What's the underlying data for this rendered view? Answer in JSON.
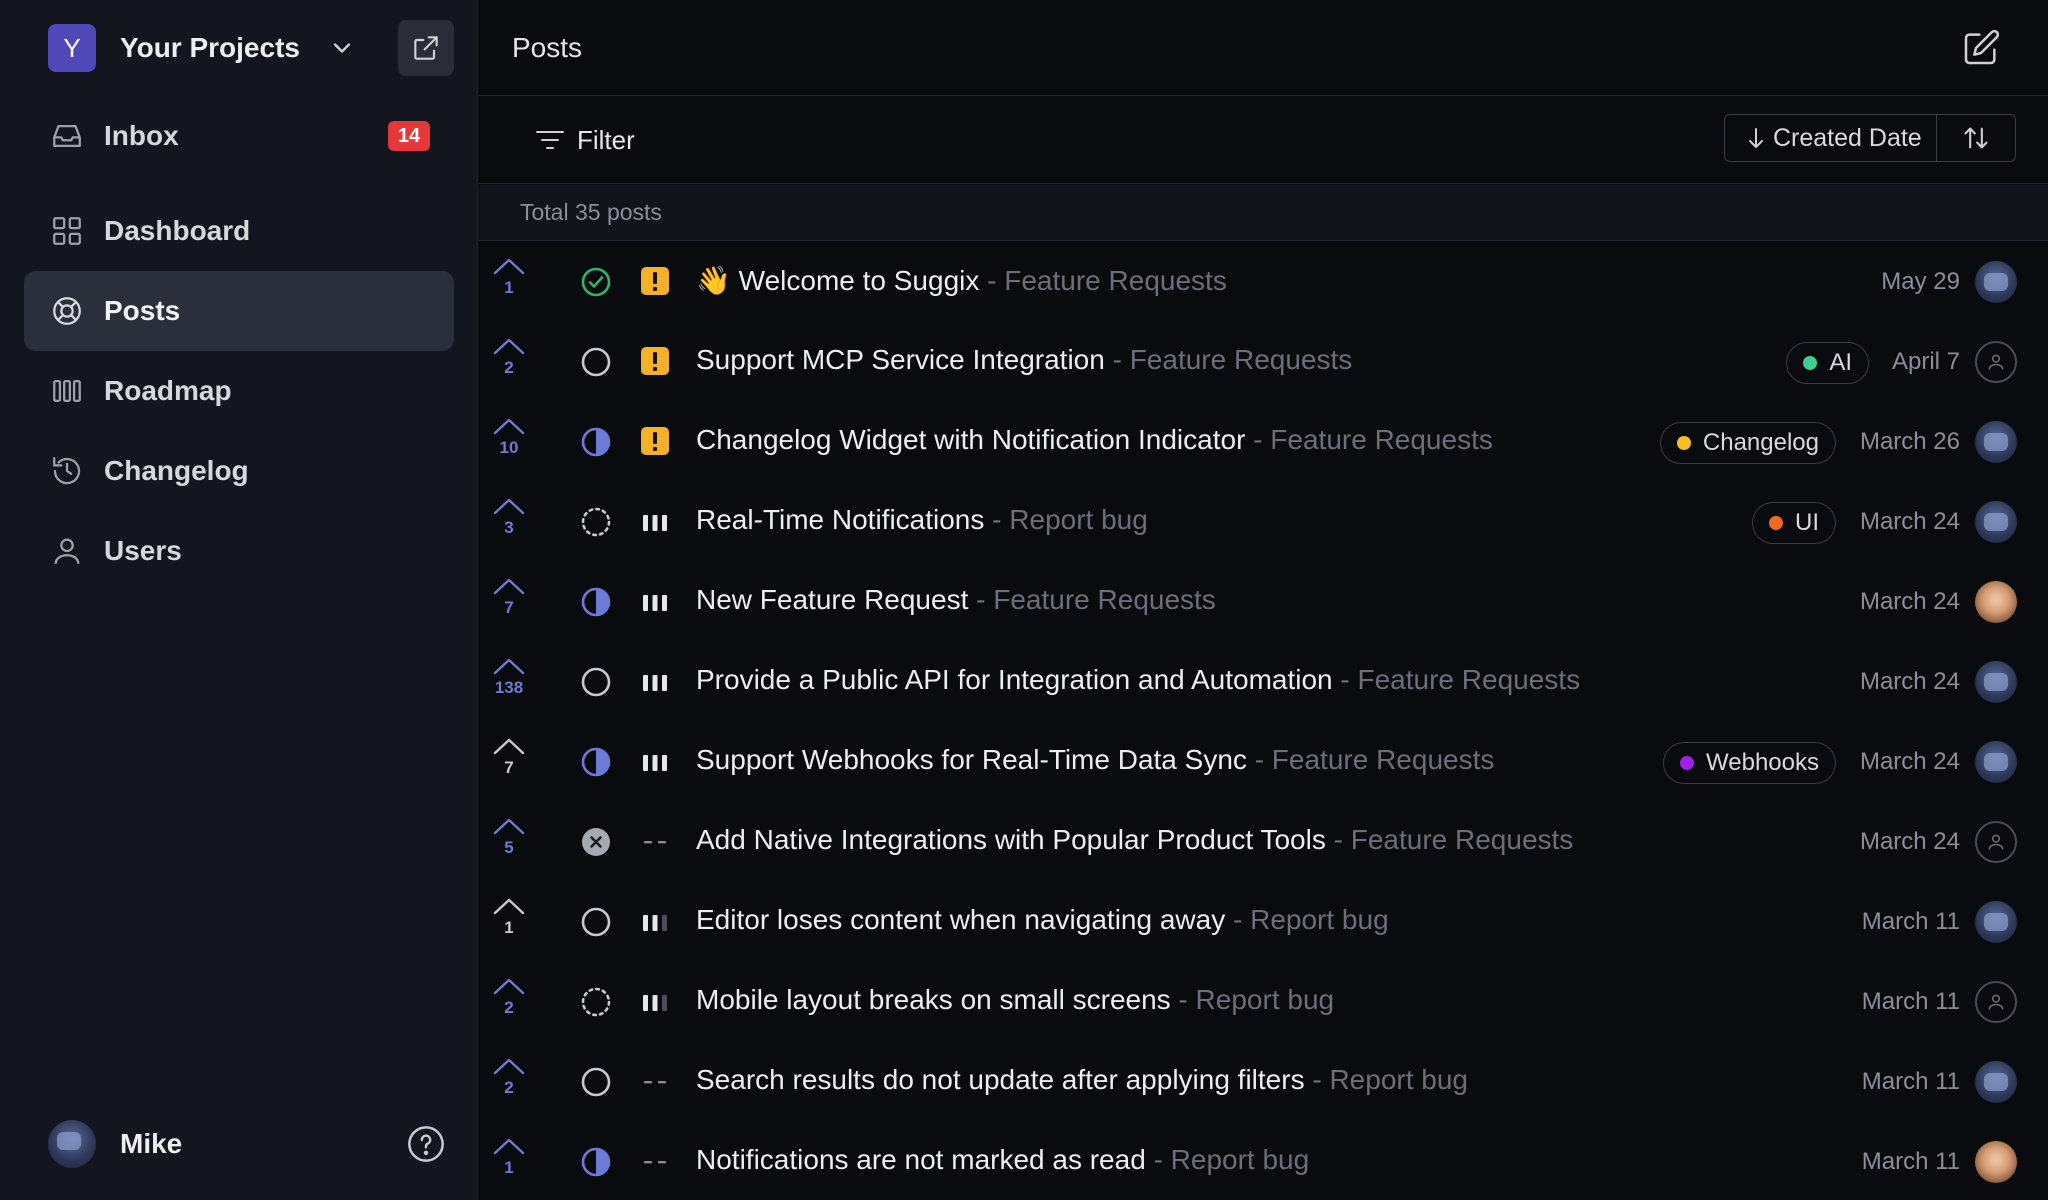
{
  "workspace": {
    "initial": "Y",
    "name": "Your Projects"
  },
  "nav": [
    {
      "label": "Inbox",
      "icon": "inbox-icon",
      "badge": "14"
    },
    {
      "label": "Dashboard",
      "icon": "dashboard-icon"
    },
    {
      "label": "Posts",
      "icon": "posts-icon",
      "active": true
    },
    {
      "label": "Roadmap",
      "icon": "roadmap-icon"
    },
    {
      "label": "Changelog",
      "icon": "changelog-icon"
    },
    {
      "label": "Users",
      "icon": "users-icon"
    }
  ],
  "user": {
    "name": "Mike"
  },
  "header": {
    "title": "Posts"
  },
  "toolbar": {
    "filter_label": "Filter",
    "sort_label": "Created Date"
  },
  "summary": {
    "total": "Total 35 posts"
  },
  "colors": {
    "accent": "#6e7bd6",
    "badge": "#e5383b",
    "done": "#2fb56a",
    "priority_urgent": "#f5b12a",
    "tag_ai": "#3fcf8e",
    "tag_changelog": "#f4c021",
    "tag_ui": "#f06a1f",
    "tag_webhooks": "#a020f0"
  },
  "posts": [
    {
      "votes": "1",
      "voted": true,
      "status": "done",
      "priority": "urgent",
      "emoji": "👋",
      "title": "Welcome to Suggix",
      "board": "- Feature Requests",
      "tag": null,
      "date": "May 29",
      "avatar": "robot"
    },
    {
      "votes": "2",
      "voted": true,
      "status": "open",
      "priority": "urgent",
      "emoji": "",
      "title": "Support MCP Service Integration",
      "board": "- Feature Requests",
      "tag": {
        "label": "AI",
        "color": "#3fcf8e"
      },
      "date": "April 7",
      "avatar": "empty"
    },
    {
      "votes": "10",
      "voted": true,
      "status": "in-progress",
      "priority": "urgent",
      "emoji": "",
      "title": "Changelog Widget with Notification Indicator",
      "board": "- Feature Requests",
      "tag": {
        "label": "Changelog",
        "color": "#f4c021"
      },
      "date": "March 26",
      "avatar": "robot"
    },
    {
      "votes": "3",
      "voted": true,
      "status": "planned",
      "priority": "high",
      "emoji": "",
      "title": "Real-Time Notifications",
      "board": "- Report bug",
      "tag": {
        "label": "UI",
        "color": "#f06a1f"
      },
      "date": "March 24",
      "avatar": "robot"
    },
    {
      "votes": "7",
      "voted": true,
      "status": "in-progress",
      "priority": "high",
      "emoji": "",
      "title": "New Feature Request",
      "board": "- Feature Requests",
      "tag": null,
      "date": "March 24",
      "avatar": "face"
    },
    {
      "votes": "138",
      "voted": true,
      "status": "open",
      "priority": "high",
      "emoji": "",
      "title": "Provide a Public API for Integration and Automation",
      "board": "- Feature Requests",
      "tag": null,
      "date": "March 24",
      "avatar": "robot"
    },
    {
      "votes": "7",
      "voted": false,
      "status": "in-progress",
      "priority": "high",
      "emoji": "",
      "title": "Support Webhooks for Real-Time Data Sync",
      "board": "- Feature Requests",
      "tag": {
        "label": "Webhooks",
        "color": "#a020f0"
      },
      "date": "March 24",
      "avatar": "robot"
    },
    {
      "votes": "5",
      "voted": true,
      "status": "closed",
      "priority": "none",
      "emoji": "",
      "title": "Add Native Integrations with Popular Product Tools",
      "board": "- Feature Requests",
      "tag": null,
      "date": "March 24",
      "avatar": "empty"
    },
    {
      "votes": "1",
      "voted": false,
      "status": "open",
      "priority": "medium",
      "emoji": "",
      "title": "Editor loses content when navigating away",
      "board": "- Report bug",
      "tag": null,
      "date": "March 11",
      "avatar": "robot"
    },
    {
      "votes": "2",
      "voted": true,
      "status": "planned",
      "priority": "medium",
      "emoji": "",
      "title": "Mobile layout breaks on small screens",
      "board": "- Report bug",
      "tag": null,
      "date": "March 11",
      "avatar": "empty"
    },
    {
      "votes": "2",
      "voted": true,
      "status": "open",
      "priority": "none",
      "emoji": "",
      "title": "Search results do not update after applying filters",
      "board": "- Report bug",
      "tag": null,
      "date": "March 11",
      "avatar": "robot"
    },
    {
      "votes": "1",
      "voted": true,
      "status": "in-progress",
      "priority": "none",
      "emoji": "",
      "title": "Notifications are not marked as read",
      "board": "- Report bug",
      "tag": null,
      "date": "March 11",
      "avatar": "face"
    }
  ]
}
